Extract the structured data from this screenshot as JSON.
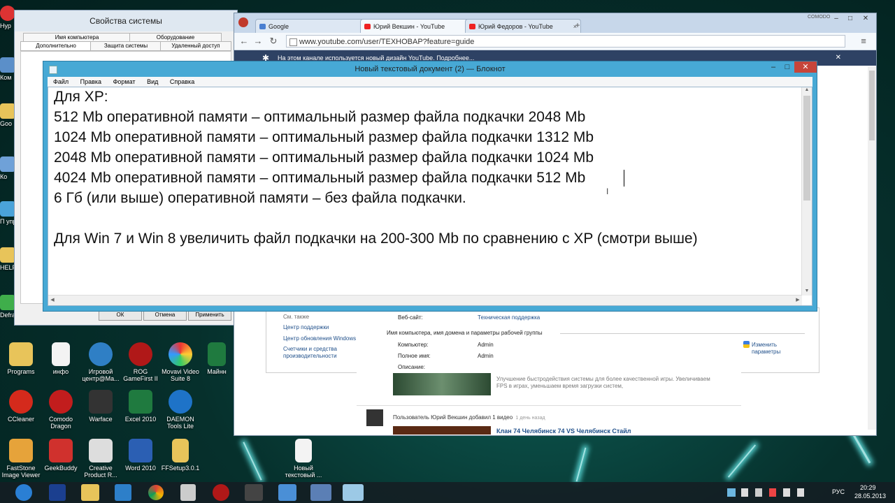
{
  "desktop": {
    "left_strip": [
      {
        "label": "Нур",
        "icon": "app-icon"
      },
      {
        "label": "Ком",
        "icon": "computer-icon"
      },
      {
        "label": "Goo",
        "icon": "folder-icon"
      },
      {
        "label": "Ко",
        "icon": "app-icon"
      },
      {
        "label": "П упр",
        "icon": "control-panel-icon"
      },
      {
        "label": "HELP!!!",
        "icon": "folder-icon"
      },
      {
        "label": "Defraggler",
        "icon": "defraggler-icon"
      }
    ],
    "icons_row1": [
      {
        "label": "Programs",
        "icon": "folder-icon"
      },
      {
        "label": "инфо",
        "icon": "document-icon"
      },
      {
        "label": "Игровой центр@Ma...",
        "icon": "game-center-icon"
      },
      {
        "label": "ROG GameFirst II",
        "icon": "rog-icon"
      },
      {
        "label": "Movavi Video Suite 8",
        "icon": "movavi-icon"
      },
      {
        "label": "Майнн",
        "icon": "excel-icon"
      }
    ],
    "icons_row2": [
      {
        "label": "CCleaner",
        "icon": "ccleaner-icon"
      },
      {
        "label": "Comodo Dragon",
        "icon": "comodo-dragon-icon"
      },
      {
        "label": "Warface",
        "icon": "warface-icon"
      },
      {
        "label": "Excel 2010",
        "icon": "excel-icon"
      },
      {
        "label": "DAEMON Tools Lite",
        "icon": "daemon-tools-icon"
      }
    ],
    "icons_row3": [
      {
        "label": "FastStone Image Viewer",
        "icon": "faststone-icon"
      },
      {
        "label": "GeekBuddy",
        "icon": "geekbuddy-icon"
      },
      {
        "label": "Creative Product R...",
        "icon": "creative-icon"
      },
      {
        "label": "Word 2010",
        "icon": "word-icon"
      },
      {
        "label": "FFSetup3.0.1",
        "icon": "archive-icon"
      },
      {
        "label": "Новый текстовый ...",
        "icon": "text-file-icon"
      }
    ]
  },
  "sysprops": {
    "title": "Свойства системы",
    "tabs_row1": [
      "Имя компьютера",
      "Оборудование"
    ],
    "tabs_row2": [
      "Дополнительно",
      "Защита системы",
      "Удаленный доступ"
    ],
    "buttons": [
      "ОК",
      "Отмена",
      "Применить"
    ]
  },
  "browser": {
    "brand": "COMODO",
    "tabs": [
      {
        "label": "Google",
        "active": false
      },
      {
        "label": "Юрий Векшин - YouTube",
        "active": true
      },
      {
        "label": "Юрий Федоров - YouTube",
        "active": false
      }
    ],
    "url": "www.youtube.com/user/TEXHOBAP?feature=guide",
    "infobar": "На этом канале используется новый дизайн YouTube. Подробнее...",
    "sysinfo": {
      "see_also": "См. также",
      "links": [
        "Центр поддержки",
        "Центр обновления Windows",
        "Счетчики и средства производительности"
      ],
      "website_label": "Веб-сайт:",
      "website_value": "Техническая поддержка",
      "group_header": "Имя компьютера, имя домена и параметры рабочей группы",
      "computer_label": "Компьютер:",
      "computer_value": "Admin",
      "fullname_label": "Полное имя:",
      "fullname_value": "Admin",
      "desc_label": "Описание:",
      "change_link": "Изменить параметры"
    },
    "feed": {
      "promo_text": "Улучшение быстродействия системы для более качественной игры. Увеличиваем FPS в играх, уменьшаем время загрузки систем,",
      "activity": "Пользователь Юрий Векшин добавил 1 видео",
      "activity_time": "1 день назад",
      "video_title": "Клан 74 Челябинск 74 VS Челябинск Стайл"
    }
  },
  "notepad": {
    "title": "Новый текстовый документ (2) — Блокнот",
    "menu": [
      "Файл",
      "Правка",
      "Формат",
      "Вид",
      "Справка"
    ],
    "lines": [
      "Для XP:",
      "512 Mb оперативной памяти – оптимальный размер файла подкачки 2048 Mb",
      "1024 Mb оперативной памяти – оптимальный размер файла подкачки 1312 Mb",
      "2048 Mb оперативной памяти – оптимальный размер файла подкачки 1024 Mb",
      "4024 Mb оперативной памяти – оптимальный размер файла подкачки 512 Mb",
      "6 Гб (или выше) оперативной памяти – без файла подкачки.",
      "",
      "Для Win 7 и Win 8 увеличить файл подкачки на 200-300 Mb по сравнению с XP (смотри выше)"
    ]
  },
  "taskbar": {
    "language": "РУС",
    "time": "20:29",
    "date": "28.05.2013"
  }
}
